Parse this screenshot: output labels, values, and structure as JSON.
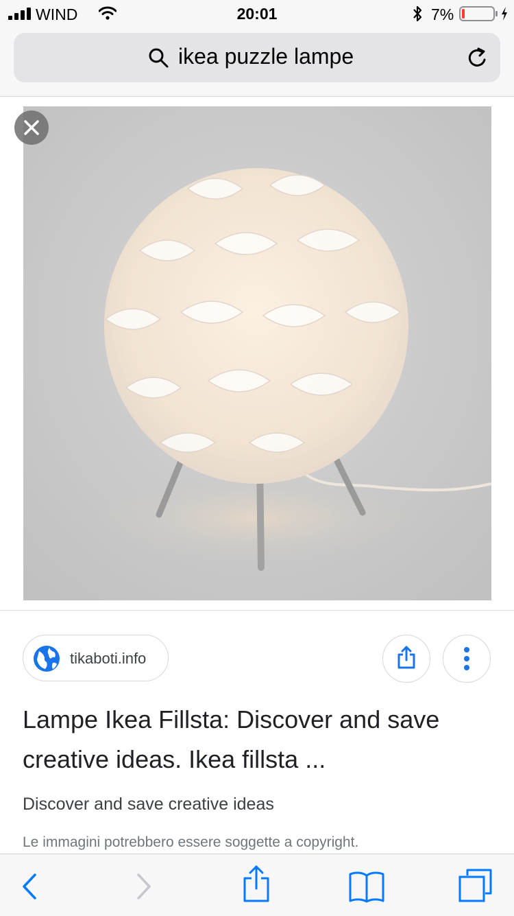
{
  "status_bar": {
    "carrier": "WIND",
    "time": "20:01",
    "battery_percent": "7%",
    "battery_level": 0.07,
    "icons": [
      "signal-icon",
      "wifi-icon",
      "bluetooth-icon",
      "battery-icon",
      "charging-icon"
    ]
  },
  "url_bar": {
    "query": "ikea puzzle lampe",
    "icons": [
      "search-icon",
      "reload-icon"
    ]
  },
  "image_viewer": {
    "close_icon": "close-icon"
  },
  "result": {
    "source": "tikaboti.info",
    "title": "Lampe Ikea Fillsta: Discover and save creative ideas. Ikea fillsta ...",
    "subtitle": "Discover and save creative ideas",
    "copyright": "Le immagini potrebbero essere soggette a copyright.",
    "icons": [
      "globe-icon",
      "share-icon",
      "more-vertical-icon"
    ]
  },
  "toolbar": {
    "icons": [
      "back-icon",
      "forward-icon",
      "share-icon",
      "bookmarks-icon",
      "tabs-icon"
    ]
  },
  "colors": {
    "accent_blue": "#1a73e8",
    "ios_blue": "#007aff",
    "battery_red": "#ff3b30"
  }
}
